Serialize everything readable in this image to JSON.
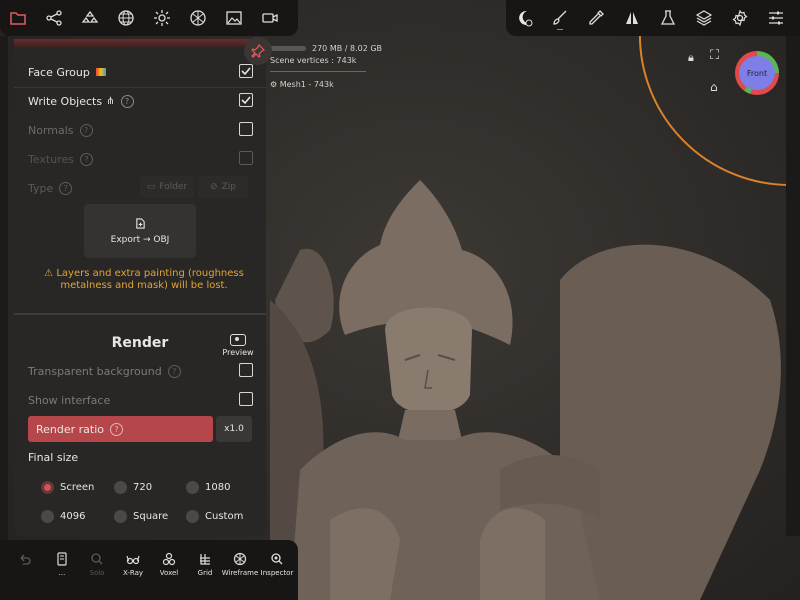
{
  "top_toolbar_left": [
    {
      "icon": "folder-icon",
      "active": true
    },
    {
      "icon": "share-nodes-icon"
    },
    {
      "icon": "scene-tree-icon"
    },
    {
      "icon": "globe-wireframe-icon"
    },
    {
      "icon": "sun-icon"
    },
    {
      "icon": "material-ball-icon"
    },
    {
      "icon": "image-icon"
    },
    {
      "icon": "video-camera-icon"
    }
  ],
  "top_toolbar_right": [
    {
      "icon": "moon-tool-icon"
    },
    {
      "icon": "brush-icon"
    },
    {
      "icon": "pipette-icon"
    },
    {
      "icon": "symmetry-icon"
    },
    {
      "icon": "flask-icon"
    },
    {
      "icon": "layers-icon"
    },
    {
      "icon": "settings-icon"
    },
    {
      "icon": "sliders-icon"
    }
  ],
  "export": {
    "face_group": {
      "label": "Face Group",
      "checked": true
    },
    "write_objects": {
      "label": "Write Objects",
      "checked": true
    },
    "normals": {
      "label": "Normals",
      "checked": false
    },
    "textures": {
      "label": "Textures",
      "checked": false,
      "disabled": true
    },
    "type": {
      "label": "Type",
      "folder": "Folder",
      "zip": "Zip"
    },
    "export_button": "Export → OBJ",
    "warning": "Layers and extra painting (roughness metalness and mask) will be lost."
  },
  "render": {
    "title": "Render",
    "preview": "Preview",
    "transparent_background": {
      "label": "Transparent background",
      "checked": false
    },
    "show_interface": {
      "label": "Show interface",
      "checked": false
    },
    "render_ratio": {
      "label": "Render ratio",
      "value": "x1.0"
    },
    "final_size": {
      "label": "Final size",
      "options": [
        {
          "label": "Screen",
          "selected": true
        },
        {
          "label": "720",
          "selected": false
        },
        {
          "label": "1080",
          "selected": false
        },
        {
          "label": "4096",
          "selected": false
        },
        {
          "label": "Square",
          "selected": false
        },
        {
          "label": "Custom",
          "selected": false
        }
      ]
    }
  },
  "scene_info": {
    "memory": "270 MB / 8.02 GB",
    "vertices": "Scene vertices : 743k",
    "mesh": "Mesh1 - 743k"
  },
  "view_gizmo": {
    "label": "Front"
  },
  "bottom_toolbar": [
    {
      "label": "",
      "icon": "undo-icon",
      "disabled": true
    },
    {
      "label": "...",
      "icon": "file-icon",
      "disabled": false
    },
    {
      "label": "Solo",
      "icon": "search-icon",
      "disabled": true
    },
    {
      "label": "X-Ray",
      "icon": "glasses-icon",
      "disabled": false
    },
    {
      "label": "Voxel",
      "icon": "voxel-icon",
      "disabled": false
    },
    {
      "label": "Grid",
      "icon": "grid-icon",
      "disabled": false
    },
    {
      "label": "Wireframe",
      "icon": "wireframe-icon",
      "disabled": false
    },
    {
      "label": "Inspector",
      "icon": "inspector-icon",
      "disabled": false
    }
  ],
  "colors": {
    "accent": "#b5474a",
    "warning": "#e0a437",
    "panel": "#292725",
    "toolbar": "#171615"
  }
}
